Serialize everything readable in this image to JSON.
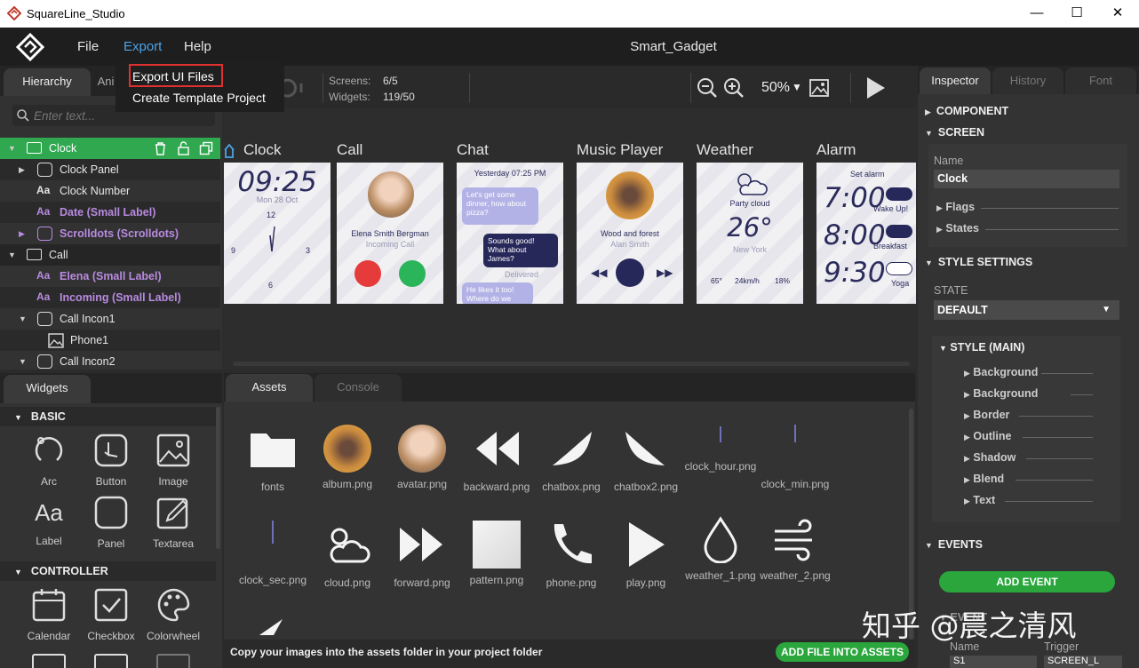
{
  "window": {
    "title": "SquareLine_Studio",
    "minimize": "—",
    "maximize": "☐",
    "close": "✕"
  },
  "menubar": {
    "file": "File",
    "export": "Export",
    "help": "Help",
    "project_name": "Smart_Gadget"
  },
  "export_menu": {
    "item1": "Export UI Files",
    "item2": "Create Template Project"
  },
  "hierarchy": {
    "tab_hierarchy": "Hierarchy",
    "tab_animation": "Ani",
    "search_placeholder": "Enter text...",
    "rows": [
      {
        "label": "Clock",
        "type": "screen",
        "arrow": "▼"
      },
      {
        "label": "Clock Panel",
        "type": "panel",
        "arrow": "▶"
      },
      {
        "label": "Clock Number",
        "type": "label",
        "arrow": ""
      },
      {
        "label": "Date (Small Label)",
        "type": "label",
        "arrow": ""
      },
      {
        "label": "Scrolldots (Scrolldots)",
        "type": "panel",
        "arrow": "▶"
      },
      {
        "label": "Call",
        "type": "screen",
        "arrow": "▼"
      },
      {
        "label": "Elena (Small Label)",
        "type": "label",
        "arrow": ""
      },
      {
        "label": "Incoming (Small Label)",
        "type": "label",
        "arrow": ""
      },
      {
        "label": "Call Incon1",
        "type": "panel",
        "arrow": "▼"
      },
      {
        "label": "Phone1",
        "type": "image",
        "arrow": ""
      },
      {
        "label": "Call Incon2",
        "type": "panel",
        "arrow": "▼"
      }
    ]
  },
  "toolbar": {
    "screens_label": "Screens:",
    "screens_value": "6/5",
    "widgets_label": "Widgets:",
    "widgets_value": "119/50",
    "zoom": "50%",
    "zoom_arrow": "▼"
  },
  "screens": [
    {
      "name": "Clock",
      "time": "09:25",
      "date": "Mon 28 Oct",
      "n12": "12",
      "n3": "3",
      "n6": "6",
      "n9": "9"
    },
    {
      "name": "Call",
      "person": "Elena Smith Bergman",
      "status": "Incoming Call"
    },
    {
      "name": "Chat",
      "header": "Yesterday 07:25 PM",
      "msg1": "Let's get some dinner, how about pizza?",
      "msg2": "Sounds good! What about James?",
      "delivered": "Delivered",
      "msg3": "He likes it too! Where do we"
    },
    {
      "name": "Music Player",
      "song": "Wood and forest",
      "artist": "Alan Smith"
    },
    {
      "name": "Weather",
      "cond": "Party cloud",
      "temp": "26°",
      "city": "New York",
      "hum": "65°",
      "wind": "24km/h",
      "rain": "18%"
    },
    {
      "name": "Alarm",
      "title": "Set alarm",
      "a1": "7:00",
      "l1": "Wake Up!",
      "a2": "8:00",
      "l2": "Breakfast",
      "a3": "9:30",
      "l3": "Yoga"
    }
  ],
  "widgets": {
    "tab": "Widgets",
    "sec_basic": "BASIC",
    "sec_controller": "CONTROLLER",
    "basic": [
      "Arc",
      "Button",
      "Image",
      "Label",
      "Panel",
      "Textarea"
    ],
    "controller": [
      "Calendar",
      "Checkbox",
      "Colorwheel"
    ]
  },
  "assets": {
    "tab_assets": "Assets",
    "tab_console": "Console",
    "files": [
      "fonts",
      "album.png",
      "avatar.png",
      "backward.png",
      "chatbox.png",
      "chatbox2.png",
      "clock_hour.png",
      "clock_min.png",
      "clock_sec.png",
      "cloud.png",
      "forward.png",
      "pattern.png",
      "phone.png",
      "play.png",
      "weather_1.png",
      "weather_2.png"
    ],
    "hint": "Copy your images into the assets folder in your project folder",
    "add_button": "ADD FILE INTO ASSETS"
  },
  "inspector": {
    "tab_inspector": "Inspector",
    "tab_history": "History",
    "tab_font": "Font",
    "component": "COMPONENT",
    "screen": "SCREEN",
    "name_label": "Name",
    "name_value": "Clock",
    "flags": "Flags",
    "states": "States",
    "style_settings": "STYLE SETTINGS",
    "state_label": "STATE",
    "state_value": "DEFAULT",
    "style_main": "STYLE (MAIN)",
    "style_items": [
      "Background",
      "Background",
      "Border",
      "Outline",
      "Shadow",
      "Blend",
      "Text"
    ],
    "events": "EVENTS",
    "add_event": "ADD EVENT",
    "event_label": "EVENT",
    "col_name": "Name",
    "col_trigger": "Trigger",
    "row_name": "S1",
    "row_trigger": "SCREEN_L"
  },
  "watermark": "知乎 @晨之清风",
  "colors": {
    "accent_green": "#2fa84f",
    "purple_label": "#b88ae0",
    "highlight_red": "#e03030",
    "export_blue": "#4aa3e8"
  }
}
